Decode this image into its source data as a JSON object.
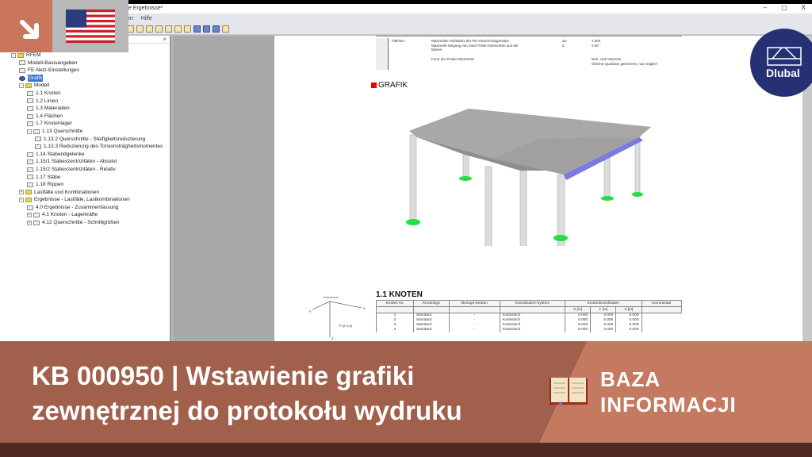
{
  "window": {
    "title": "te Ergebnisse*",
    "controls": [
      "–",
      "▢",
      "X"
    ]
  },
  "menu": [
    "en",
    "Hilfe"
  ],
  "panel": {
    "close": "×"
  },
  "tree": [
    {
      "label": "RFEM",
      "level": 0,
      "icon": "folder",
      "exp": "−"
    },
    {
      "label": "Modell-Basisangaben",
      "level": 1,
      "icon": "table"
    },
    {
      "label": "FE-Netz-Einstellungen",
      "level": 1,
      "icon": "table"
    },
    {
      "label": "Grafik",
      "level": 1,
      "icon": "globe",
      "selected": true
    },
    {
      "label": "Modell",
      "level": 1,
      "icon": "folder",
      "exp": "−"
    },
    {
      "label": "1.1 Knoten",
      "level": 2,
      "icon": "table"
    },
    {
      "label": "1.2 Linien",
      "level": 2,
      "icon": "table"
    },
    {
      "label": "1.3 Materialien",
      "level": 2,
      "icon": "table"
    },
    {
      "label": "1.4 Flächen",
      "level": 2,
      "icon": "table"
    },
    {
      "label": "1.7 Knotenlager",
      "level": 2,
      "icon": "table"
    },
    {
      "label": "1.13 Querschnitte",
      "level": 2,
      "icon": "table",
      "exp": "−"
    },
    {
      "label": "1.13.2 Querschnitte - Steifigkeitsreduzierung",
      "level": 3,
      "icon": "table"
    },
    {
      "label": "1.13.3 Reduzierung des Torsionsträgheitsmomentes",
      "level": 3,
      "icon": "table"
    },
    {
      "label": "1.14 Stabendgelenke",
      "level": 2,
      "icon": "table"
    },
    {
      "label": "1.15/1 Stabexzentrizitäten - Absolut",
      "level": 2,
      "icon": "table"
    },
    {
      "label": "1.15/2 Stabexzentrizitäten - Relativ",
      "level": 2,
      "icon": "table"
    },
    {
      "label": "1.17 Stäbe",
      "level": 2,
      "icon": "table"
    },
    {
      "label": "1.18 Rippen",
      "level": 2,
      "icon": "table"
    },
    {
      "label": "Lastfälle und Kombinationen",
      "level": 1,
      "icon": "folder",
      "exp": "+"
    },
    {
      "label": "Ergebnisse - Lastfälle, Lastkombinationen",
      "level": 1,
      "icon": "folder",
      "exp": "−"
    },
    {
      "label": "4.0 Ergebnisse - Zusammenfassung",
      "level": 2,
      "icon": "table"
    },
    {
      "label": "4.1 Knoten - Lagerkräfte",
      "level": 2,
      "icon": "table",
      "exp": "+"
    },
    {
      "label": "4.12 Querschnitte - Schnittgrößen",
      "level": 2,
      "icon": "table",
      "exp": "+"
    }
  ],
  "report": {
    "header": {
      "section": "Flächen",
      "rows": [
        {
          "label": "Maximales Verhältnis der FE-Viereck-Diagonalen",
          "sym": "Δᴅ",
          "val": "1.800"
        },
        {
          "label": "Maximale Neigung von zwei Finiten Elementen aus der Ebene",
          "sym": "α",
          "val": "0.50 °"
        },
        {
          "label": "Form der Finiten Elemente:",
          "sym": "",
          "val": "Drei- und Vierecke"
        }
      ],
      "option": "Gleiche Quadrate generieren, wo möglich"
    },
    "grafik_title": "GRAFIK",
    "knoten_title": "1.1 KNOTEN",
    "coord_label": "Kartesisch",
    "coord_axes": {
      "x": "X",
      "y": "Y",
      "z": "Z",
      "p": "P (X,Y,Z)"
    },
    "table": {
      "headers": [
        "Knoten Nr.",
        "Knotentyp",
        "Bezugs-Knoten",
        "Koordinaten-System",
        "X [m]",
        "Y [m]",
        "Z [m]",
        "Kommentar"
      ],
      "group": "Knotenkoordinaten",
      "rows": [
        [
          "1",
          "Standard",
          "-",
          "Kartesisch",
          "0.000",
          "0.000",
          "0.000",
          ""
        ],
        [
          "2",
          "Standard",
          "-",
          "Kartesisch",
          "0.000",
          "5.000",
          "0.000",
          ""
        ],
        [
          "3",
          "Standard",
          "-",
          "Kartesisch",
          "6.000",
          "5.000",
          "0.000",
          ""
        ],
        [
          "4",
          "Standard",
          "-",
          "Kartesisch",
          "6.000",
          "0.000",
          "0.000",
          ""
        ]
      ]
    }
  },
  "logo": "Dlubal",
  "banner": {
    "line1": "KB 000950 | Wstawienie grafiki",
    "line2": "zewnętrznej do protokołu wydruku",
    "category1": "BAZA",
    "category2": "INFORMACJI"
  },
  "colors": {
    "banner_dark": "#a0604c",
    "banner_light": "#c47a60",
    "strip": "#4e2a20",
    "dlubal": "#253173",
    "accent": "#c9765c"
  }
}
